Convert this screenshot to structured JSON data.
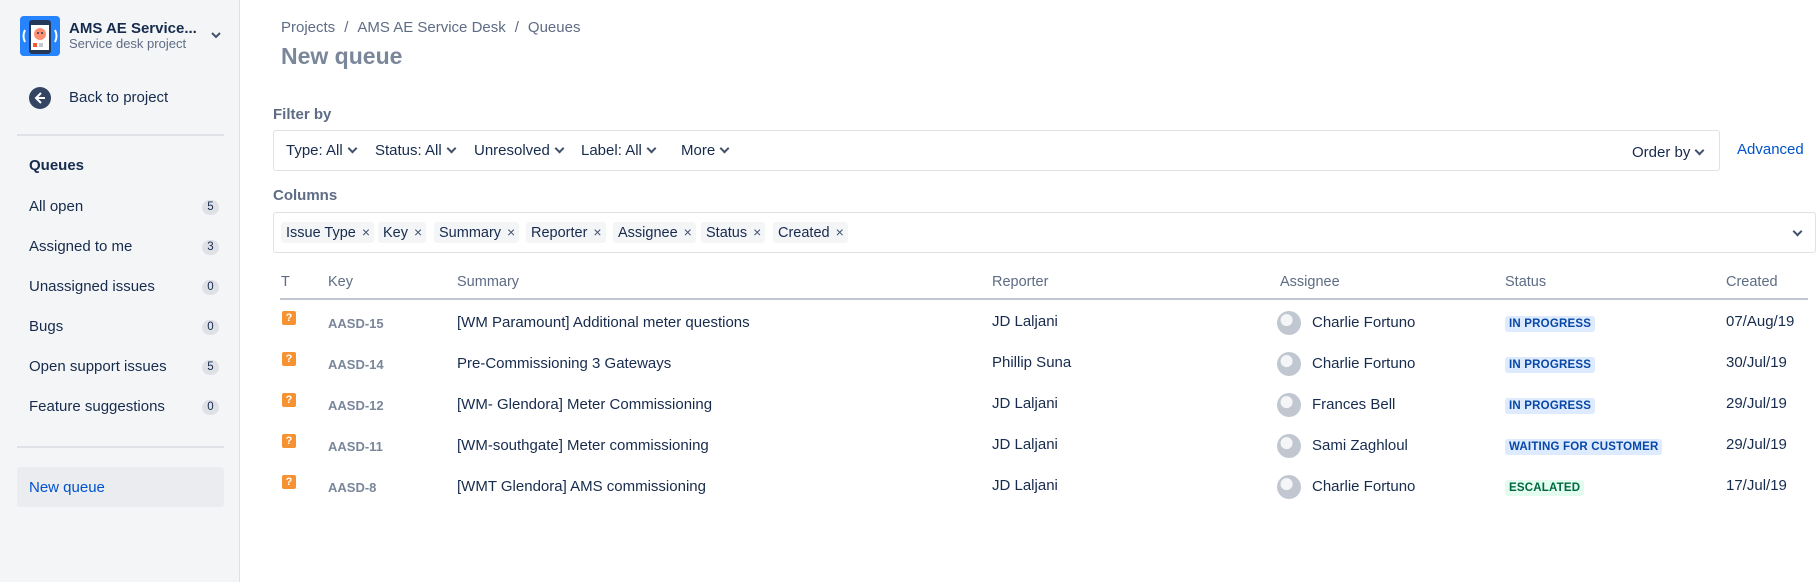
{
  "project": {
    "name": "AMS AE Service...",
    "type": "Service desk project"
  },
  "sidebar": {
    "back_label": "Back to project",
    "queues_heading": "Queues",
    "items": [
      {
        "label": "All open",
        "count": "5"
      },
      {
        "label": "Assigned to me",
        "count": "3"
      },
      {
        "label": "Unassigned issues",
        "count": "0"
      },
      {
        "label": "Bugs",
        "count": "0"
      },
      {
        "label": "Open support issues",
        "count": "5"
      },
      {
        "label": "Feature suggestions",
        "count": "0"
      }
    ],
    "new_queue_label": "New queue"
  },
  "breadcrumb": [
    "Projects",
    "AMS AE Service Desk",
    "Queues"
  ],
  "page_title": "New queue",
  "filter": {
    "heading": "Filter by",
    "buttons": [
      "Type: All",
      "Status: All",
      "Unresolved",
      "Label: All",
      "More"
    ],
    "order_by": "Order by",
    "advanced": "Advanced"
  },
  "columns": {
    "heading": "Columns",
    "tags": [
      "Issue Type",
      "Key",
      "Summary",
      "Reporter",
      "Assignee",
      "Status",
      "Created"
    ],
    "remove_glyph": "×"
  },
  "table": {
    "headers": [
      "T",
      "Key",
      "Summary",
      "Reporter",
      "Assignee",
      "Status",
      "Created"
    ],
    "type_icon_glyph": "?",
    "rows": [
      {
        "key": "AASD-15",
        "summary": "[WM Paramount] Additional meter questions",
        "reporter": "JD Laljani",
        "assignee": "Charlie Fortuno",
        "status": "IN PROGRESS",
        "status_kind": "progress",
        "created": "07/Aug/19"
      },
      {
        "key": "AASD-14",
        "summary": "Pre-Commissioning 3 Gateways",
        "reporter": "Phillip Suna",
        "assignee": "Charlie Fortuno",
        "status": "IN PROGRESS",
        "status_kind": "progress",
        "created": "30/Jul/19"
      },
      {
        "key": "AASD-12",
        "summary": "[WM- Glendora] Meter Commissioning",
        "reporter": "JD Laljani",
        "assignee": "Frances Bell",
        "status": "IN PROGRESS",
        "status_kind": "progress",
        "created": "29/Jul/19"
      },
      {
        "key": "AASD-11",
        "summary": "[WM-southgate] Meter commissioning",
        "reporter": "JD Laljani",
        "assignee": "Sami Zaghloul",
        "status": "WAITING FOR CUSTOMER",
        "status_kind": "progress",
        "created": "29/Jul/19"
      },
      {
        "key": "AASD-8",
        "summary": "[WMT Glendora] AMS commissioning",
        "reporter": "JD Laljani",
        "assignee": "Charlie Fortuno",
        "status": "ESCALATED",
        "status_kind": "success",
        "created": "17/Jul/19"
      }
    ]
  },
  "icons": {
    "project_avatar": "service-desk-robot-icon",
    "back": "arrow-left-circle-icon",
    "chevron": "chevron-down-icon",
    "issue_type": "question-issue-type-icon",
    "avatar": "user-avatar"
  },
  "colors": {
    "brand_blue": "#0052cc",
    "progress_bg": "#deebff",
    "progress_fg": "#0747a6",
    "success_bg": "#e3fcef",
    "success_fg": "#006644",
    "issue_type_orange": "#f79232"
  }
}
